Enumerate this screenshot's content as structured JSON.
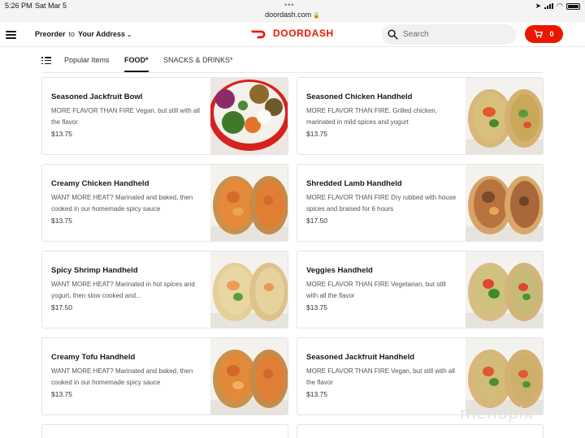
{
  "status_bar": {
    "time": "5:26 PM",
    "date": "Sat Mar 5",
    "url": "doordash.com"
  },
  "header": {
    "preorder": "Preorder",
    "to": "to",
    "address": "Your Address",
    "brand": "DOORDASH",
    "search_placeholder": "Search",
    "cart_count": "0",
    "accent_color": "#eb1700"
  },
  "tabs": [
    {
      "label": "Popular Items",
      "active": false
    },
    {
      "label": "FOOD*",
      "active": true
    },
    {
      "label": "SNACKS & DRINKS*",
      "active": false
    }
  ],
  "items": [
    {
      "name": "Seasoned Jackfruit Bowl",
      "desc": "MORE FLAVOR THAN FIRE Vegan, but still with all the flavor",
      "price": "$13.75",
      "image": "bowl"
    },
    {
      "name": "Seasoned Chicken Handheld",
      "desc": "MORE FLAVOR THAN FIRE.  Grilled chicken, marinated in mild spices and yogurt",
      "price": "$13.75",
      "image": "wrap"
    },
    {
      "name": "Creamy Chicken Handheld",
      "desc": "WANT MORE HEAT? Marinated and baked, then cooked in our homemade spicy sauce",
      "price": "$13.75",
      "image": "wrap"
    },
    {
      "name": "Shredded Lamb Handheld",
      "desc": "MORE FLAVOR THAN FIRE Dry rubbed with house spices and braised for 6 hours",
      "price": "$17.50",
      "image": "wrap"
    },
    {
      "name": "Spicy Shrimp Handheld",
      "desc": "WANT MORE HEAT? Marinated in hot spices and yogurt, then slow cooked and...",
      "price": "$17.50",
      "image": "wrap"
    },
    {
      "name": "Veggies Handheld",
      "desc": "MORE FLAVOR THAN FIRE Vegetarian, but still with all the flavor",
      "price": "$13.75",
      "image": "wrap"
    },
    {
      "name": "Creamy Tofu Handheld",
      "desc": "WANT MORE HEAT? Marinated and baked, then cooked in our homemade spicy sauce",
      "price": "$13.75",
      "image": "wrap"
    },
    {
      "name": "Seasoned Jackfruit Handheld",
      "desc": "MORE FLAVOR THAN FIRE Vegan, but still with all the flavor",
      "price": "$13.75",
      "image": "wrap"
    }
  ],
  "watermark": "menupix"
}
